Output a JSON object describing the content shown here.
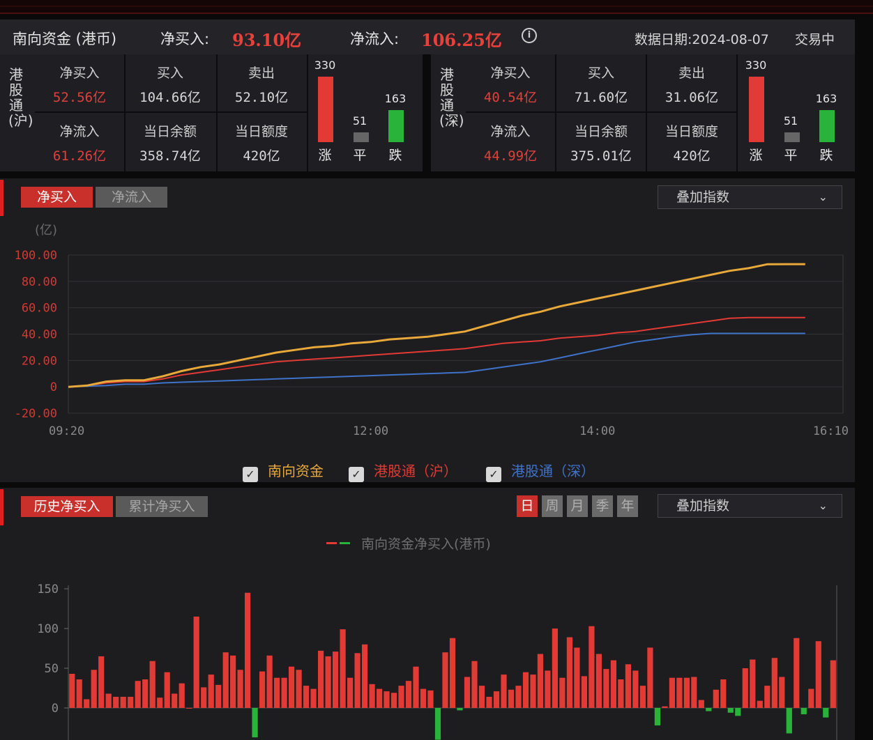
{
  "header": {
    "title": "南向资金 (港币)",
    "net_buy_label": "净买入:",
    "net_buy_value": "93.10亿",
    "net_inflow_label": "净流入:",
    "net_inflow_value": "106.25亿",
    "info_icon": "i",
    "data_date": "数据日期:2024-08-07",
    "status": "交易中"
  },
  "sh": {
    "label": "港股通(沪)",
    "net_buy_label": "净买入",
    "net_buy": "52.56亿",
    "buy_label": "买入",
    "buy": "104.66亿",
    "sell_label": "卖出",
    "sell": "52.10亿",
    "net_inflow_label": "净流入",
    "net_inflow": "61.26亿",
    "balance_label": "当日余额",
    "balance": "358.74亿",
    "quota_label": "当日额度",
    "quota": "420亿",
    "up_count": "330",
    "flat_count": "51",
    "down_count": "163",
    "up_label": "涨",
    "flat_label": "平",
    "down_label": "跌"
  },
  "sz": {
    "label": "港股通(深)",
    "net_buy_label": "净买入",
    "net_buy": "40.54亿",
    "buy_label": "买入",
    "buy": "71.60亿",
    "sell_label": "卖出",
    "sell": "31.06亿",
    "net_inflow_label": "净流入",
    "net_inflow": "44.99亿",
    "balance_label": "当日余额",
    "balance": "375.01亿",
    "quota_label": "当日额度",
    "quota": "420亿",
    "up_count": "330",
    "flat_count": "51",
    "down_count": "163",
    "up_label": "涨",
    "flat_label": "平",
    "down_label": "跌"
  },
  "intraday": {
    "tab_active": "净买入",
    "tab_inactive": "净流入",
    "overlay_dropdown": "叠加指数",
    "unit": "(亿)",
    "legend": [
      {
        "label": "南向资金",
        "color": "#e8a93a"
      },
      {
        "label": "港股通（沪）",
        "color": "#e23a34"
      },
      {
        "label": "港股通（深）",
        "color": "#3f73c9"
      }
    ]
  },
  "history": {
    "tab_active": "历史净买入",
    "tab_inactive": "累计净买入",
    "periods": [
      "日",
      "周",
      "月",
      "季",
      "年"
    ],
    "overlay_dropdown": "叠加指数",
    "legend_label": "南向资金净买入(港币)"
  },
  "colors": {
    "up": "#e23a34",
    "flat": "#666666",
    "down": "#29b33a",
    "southbound": "#e8a93a",
    "sh": "#e23a34",
    "sz": "#3f73c9",
    "accent": "#c9302c"
  },
  "chart_data": [
    {
      "type": "line",
      "ylabel": "(亿)",
      "ylim": [
        -20,
        100
      ],
      "y_ticks": [
        "100.00",
        "80.00",
        "60.00",
        "40.00",
        "20.00",
        "0",
        "-20.00"
      ],
      "x_ticks": [
        "09:20",
        "12:00",
        "14:00",
        "16:10"
      ],
      "grid": true,
      "x": [
        "09:20",
        "09:30",
        "09:40",
        "09:50",
        "10:00",
        "10:10",
        "10:20",
        "10:30",
        "10:40",
        "10:50",
        "11:00",
        "11:10",
        "11:20",
        "11:30",
        "11:40",
        "11:50",
        "12:00",
        "12:10",
        "12:20",
        "12:30",
        "12:40",
        "12:50",
        "13:00",
        "13:10",
        "13:20",
        "13:30",
        "13:40",
        "13:50",
        "14:00",
        "14:10",
        "14:20",
        "14:30",
        "14:40",
        "14:50",
        "15:00",
        "15:10",
        "15:20",
        "15:30",
        "15:40",
        "15:50"
      ],
      "series": [
        {
          "name": "南向资金",
          "values": [
            0,
            1,
            4,
            5,
            5,
            8,
            12,
            15,
            17,
            20,
            23,
            26,
            28,
            30,
            31,
            33,
            34,
            36,
            37,
            38,
            40,
            42,
            46,
            50,
            54,
            57,
            61,
            64,
            67,
            70,
            73,
            76,
            79,
            82,
            85,
            88,
            90,
            93,
            93.1,
            93.1
          ]
        },
        {
          "name": "港股通（沪）",
          "values": [
            0,
            1,
            3,
            4,
            4,
            6,
            9,
            11,
            13,
            15,
            17,
            19,
            20,
            21,
            22,
            23,
            24,
            25,
            26,
            27,
            28,
            29,
            31,
            33,
            34,
            35,
            37,
            38,
            39,
            41,
            42,
            44,
            46,
            48,
            50,
            52,
            52.56,
            52.56,
            52.56,
            52.56
          ]
        },
        {
          "name": "港股通（深）",
          "values": [
            0,
            0.5,
            1,
            2,
            2,
            3,
            3.5,
            4,
            4.5,
            5,
            5.5,
            6,
            6.5,
            7,
            7.5,
            8,
            8.5,
            9,
            9.5,
            10,
            10.5,
            11,
            13,
            15,
            17,
            19,
            22,
            25,
            28,
            31,
            34,
            36,
            38,
            39.5,
            40.54,
            40.54,
            40.54,
            40.54,
            40.54,
            40.54
          ]
        }
      ]
    },
    {
      "type": "bar",
      "title": "南向资金净买入(港币)",
      "ylim": [
        -40,
        150
      ],
      "y_ticks": [
        "150",
        "100",
        "50",
        "0"
      ],
      "series": [
        {
          "name": "南向资金净买入(港币)",
          "values": [
            43,
            36,
            11,
            48,
            65,
            18,
            14,
            14,
            14,
            34,
            36,
            59,
            13,
            45,
            18,
            31,
            0,
            115,
            26,
            42,
            29,
            70,
            66,
            48,
            145,
            -37,
            46,
            66,
            38,
            38,
            52,
            48,
            28,
            24,
            72,
            65,
            71,
            99,
            38,
            69,
            80,
            30,
            24,
            21,
            19,
            28,
            34,
            52,
            24,
            22,
            -40,
            70,
            88,
            -3,
            39,
            59,
            28,
            14,
            21,
            42,
            23,
            28,
            45,
            42,
            68,
            47,
            100,
            38,
            89,
            76,
            40,
            103,
            68,
            49,
            60,
            36,
            55,
            47,
            28,
            76,
            -22,
            2,
            38,
            38,
            38,
            39,
            10,
            -4,
            23,
            36,
            -6,
            -10,
            50,
            61,
            9,
            28,
            63,
            39,
            -32,
            88,
            -8,
            24,
            84,
            -12,
            60
          ]
        }
      ]
    }
  ]
}
